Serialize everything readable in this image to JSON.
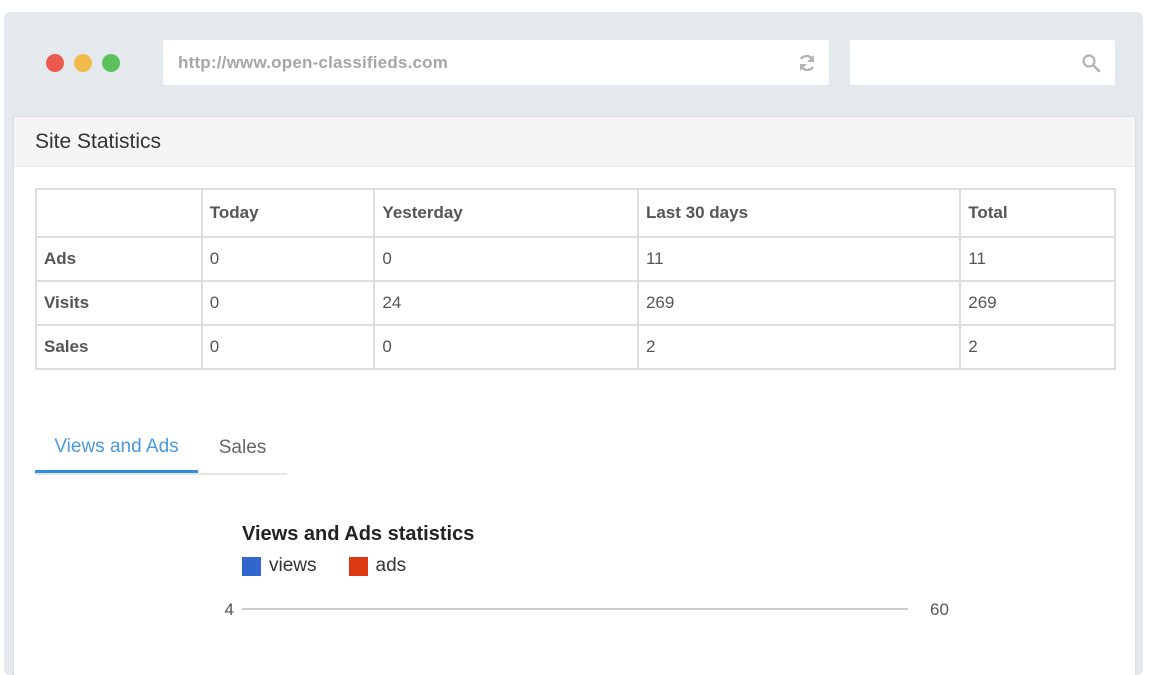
{
  "browser": {
    "url": "http://www.open-classifieds.com",
    "search_placeholder": ""
  },
  "panel": {
    "title": "Site Statistics"
  },
  "table": {
    "headers": [
      "",
      "Today",
      "Yesterday",
      "Last 30 days",
      "Total"
    ],
    "rows": [
      {
        "label": "Ads",
        "values": [
          "0",
          "0",
          "11",
          "11"
        ]
      },
      {
        "label": "Visits",
        "values": [
          "0",
          "24",
          "269",
          "269"
        ]
      },
      {
        "label": "Sales",
        "values": [
          "0",
          "0",
          "2",
          "2"
        ]
      }
    ]
  },
  "tabs": [
    {
      "label": "Views and Ads",
      "active": true
    },
    {
      "label": "Sales",
      "active": false
    }
  ],
  "chart_data": {
    "type": "line",
    "title": "Views and Ads statistics",
    "series": [
      {
        "name": "views",
        "color": "#3366cc",
        "values": []
      },
      {
        "name": "ads",
        "color": "#dc3912",
        "values": []
      }
    ],
    "y_left_label": "4",
    "y_right_label": "60",
    "legend": "top-left"
  },
  "colors": {
    "accent": "#2f8ee0",
    "close": "#ec5a4f",
    "minimize": "#f2ba4b",
    "maximize": "#5cc15b"
  },
  "icons": [
    "refresh-icon",
    "search-icon"
  ]
}
